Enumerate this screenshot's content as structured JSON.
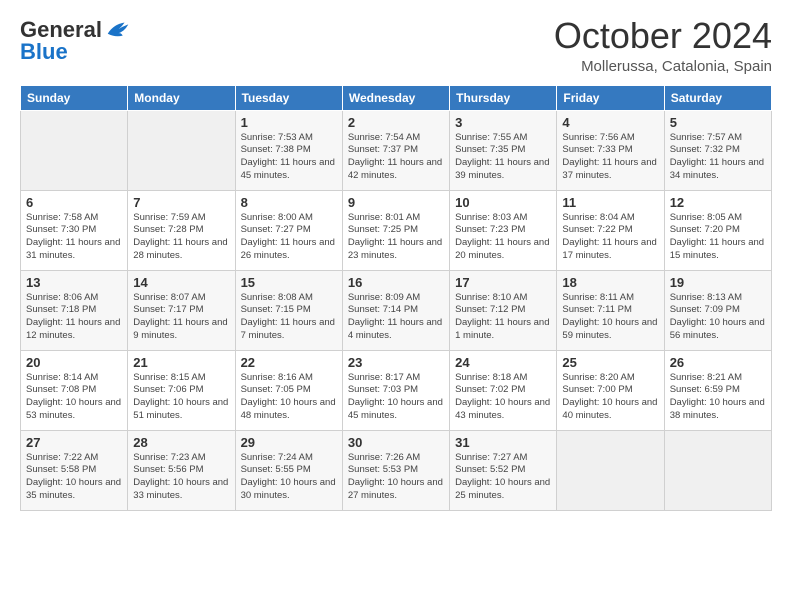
{
  "logo": {
    "line1": "General",
    "line2": "Blue"
  },
  "title": "October 2024",
  "subtitle": "Mollerussa, Catalonia, Spain",
  "days_of_week": [
    "Sunday",
    "Monday",
    "Tuesday",
    "Wednesday",
    "Thursday",
    "Friday",
    "Saturday"
  ],
  "weeks": [
    [
      {
        "day": "",
        "info": ""
      },
      {
        "day": "",
        "info": ""
      },
      {
        "day": "1",
        "info": "Sunrise: 7:53 AM\nSunset: 7:38 PM\nDaylight: 11 hours and 45 minutes."
      },
      {
        "day": "2",
        "info": "Sunrise: 7:54 AM\nSunset: 7:37 PM\nDaylight: 11 hours and 42 minutes."
      },
      {
        "day": "3",
        "info": "Sunrise: 7:55 AM\nSunset: 7:35 PM\nDaylight: 11 hours and 39 minutes."
      },
      {
        "day": "4",
        "info": "Sunrise: 7:56 AM\nSunset: 7:33 PM\nDaylight: 11 hours and 37 minutes."
      },
      {
        "day": "5",
        "info": "Sunrise: 7:57 AM\nSunset: 7:32 PM\nDaylight: 11 hours and 34 minutes."
      }
    ],
    [
      {
        "day": "6",
        "info": "Sunrise: 7:58 AM\nSunset: 7:30 PM\nDaylight: 11 hours and 31 minutes."
      },
      {
        "day": "7",
        "info": "Sunrise: 7:59 AM\nSunset: 7:28 PM\nDaylight: 11 hours and 28 minutes."
      },
      {
        "day": "8",
        "info": "Sunrise: 8:00 AM\nSunset: 7:27 PM\nDaylight: 11 hours and 26 minutes."
      },
      {
        "day": "9",
        "info": "Sunrise: 8:01 AM\nSunset: 7:25 PM\nDaylight: 11 hours and 23 minutes."
      },
      {
        "day": "10",
        "info": "Sunrise: 8:03 AM\nSunset: 7:23 PM\nDaylight: 11 hours and 20 minutes."
      },
      {
        "day": "11",
        "info": "Sunrise: 8:04 AM\nSunset: 7:22 PM\nDaylight: 11 hours and 17 minutes."
      },
      {
        "day": "12",
        "info": "Sunrise: 8:05 AM\nSunset: 7:20 PM\nDaylight: 11 hours and 15 minutes."
      }
    ],
    [
      {
        "day": "13",
        "info": "Sunrise: 8:06 AM\nSunset: 7:18 PM\nDaylight: 11 hours and 12 minutes."
      },
      {
        "day": "14",
        "info": "Sunrise: 8:07 AM\nSunset: 7:17 PM\nDaylight: 11 hours and 9 minutes."
      },
      {
        "day": "15",
        "info": "Sunrise: 8:08 AM\nSunset: 7:15 PM\nDaylight: 11 hours and 7 minutes."
      },
      {
        "day": "16",
        "info": "Sunrise: 8:09 AM\nSunset: 7:14 PM\nDaylight: 11 hours and 4 minutes."
      },
      {
        "day": "17",
        "info": "Sunrise: 8:10 AM\nSunset: 7:12 PM\nDaylight: 11 hours and 1 minute."
      },
      {
        "day": "18",
        "info": "Sunrise: 8:11 AM\nSunset: 7:11 PM\nDaylight: 10 hours and 59 minutes."
      },
      {
        "day": "19",
        "info": "Sunrise: 8:13 AM\nSunset: 7:09 PM\nDaylight: 10 hours and 56 minutes."
      }
    ],
    [
      {
        "day": "20",
        "info": "Sunrise: 8:14 AM\nSunset: 7:08 PM\nDaylight: 10 hours and 53 minutes."
      },
      {
        "day": "21",
        "info": "Sunrise: 8:15 AM\nSunset: 7:06 PM\nDaylight: 10 hours and 51 minutes."
      },
      {
        "day": "22",
        "info": "Sunrise: 8:16 AM\nSunset: 7:05 PM\nDaylight: 10 hours and 48 minutes."
      },
      {
        "day": "23",
        "info": "Sunrise: 8:17 AM\nSunset: 7:03 PM\nDaylight: 10 hours and 45 minutes."
      },
      {
        "day": "24",
        "info": "Sunrise: 8:18 AM\nSunset: 7:02 PM\nDaylight: 10 hours and 43 minutes."
      },
      {
        "day": "25",
        "info": "Sunrise: 8:20 AM\nSunset: 7:00 PM\nDaylight: 10 hours and 40 minutes."
      },
      {
        "day": "26",
        "info": "Sunrise: 8:21 AM\nSunset: 6:59 PM\nDaylight: 10 hours and 38 minutes."
      }
    ],
    [
      {
        "day": "27",
        "info": "Sunrise: 7:22 AM\nSunset: 5:58 PM\nDaylight: 10 hours and 35 minutes."
      },
      {
        "day": "28",
        "info": "Sunrise: 7:23 AM\nSunset: 5:56 PM\nDaylight: 10 hours and 33 minutes."
      },
      {
        "day": "29",
        "info": "Sunrise: 7:24 AM\nSunset: 5:55 PM\nDaylight: 10 hours and 30 minutes."
      },
      {
        "day": "30",
        "info": "Sunrise: 7:26 AM\nSunset: 5:53 PM\nDaylight: 10 hours and 27 minutes."
      },
      {
        "day": "31",
        "info": "Sunrise: 7:27 AM\nSunset: 5:52 PM\nDaylight: 10 hours and 25 minutes."
      },
      {
        "day": "",
        "info": ""
      },
      {
        "day": "",
        "info": ""
      }
    ]
  ]
}
